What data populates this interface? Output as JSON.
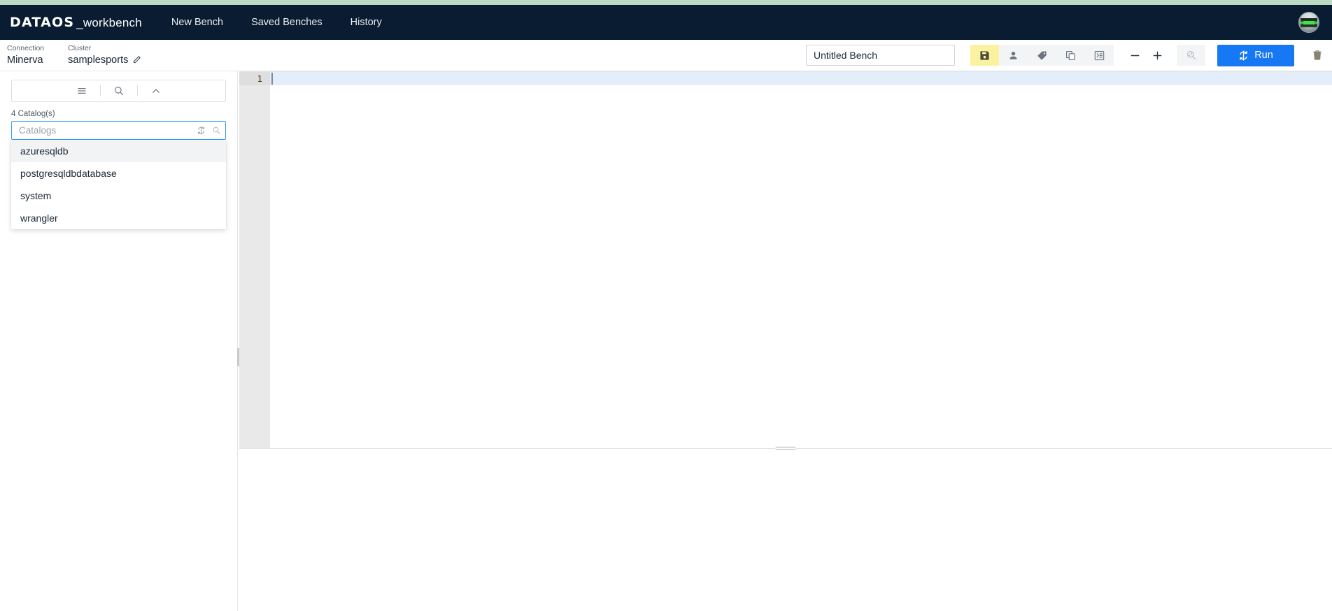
{
  "brand": {
    "primary": "DATAOS",
    "secondary": "_workbench"
  },
  "nav": {
    "links": [
      {
        "label": "New Bench",
        "name": "nav-new-bench"
      },
      {
        "label": "Saved Benches",
        "name": "nav-saved-benches"
      },
      {
        "label": "History",
        "name": "nav-history"
      }
    ]
  },
  "subbar": {
    "connection": {
      "label": "Connection",
      "value": "Minerva"
    },
    "cluster": {
      "label": "Cluster",
      "value": "samplesports"
    }
  },
  "toolbar": {
    "bench_name_value": "Untitled Bench",
    "bench_name_placeholder": "Untitled Bench",
    "icons": [
      {
        "name": "save-icon",
        "title": "Save"
      },
      {
        "name": "person-icon",
        "title": "Share"
      },
      {
        "name": "tag-icon",
        "title": "Tags"
      },
      {
        "name": "copy-icon",
        "title": "Duplicate"
      },
      {
        "name": "format-indent-icon",
        "title": "Format"
      }
    ],
    "zoom_out_label": "−",
    "zoom_in_label": "+",
    "search_icon": "search-disabled-icon",
    "run_label": "Run",
    "delete_icon": "trash-icon",
    "accent_color": "#1678f2",
    "active_icon_bg": "#fbf2a0"
  },
  "sidebar": {
    "tools": [
      {
        "name": "menu-icon"
      },
      {
        "name": "search-icon"
      },
      {
        "name": "collapse-up-icon"
      }
    ],
    "catalog_count_label": "4 Catalog(s)",
    "catalog_input_value": "",
    "catalog_input_placeholder": "Catalogs",
    "catalog_input_icons": [
      {
        "name": "refresh-icon"
      },
      {
        "name": "search-icon"
      }
    ],
    "catalogs": [
      {
        "label": "azuresqldb",
        "highlighted": true
      },
      {
        "label": "postgresqldbdatabase",
        "highlighted": false
      },
      {
        "label": "system",
        "highlighted": false
      },
      {
        "label": "wrangler",
        "highlighted": false
      }
    ]
  },
  "editor": {
    "lines": [
      {
        "number": "1",
        "text": ""
      }
    ],
    "active_line_color": "#e4eefb",
    "gutter_color": "#e9e9e9"
  }
}
